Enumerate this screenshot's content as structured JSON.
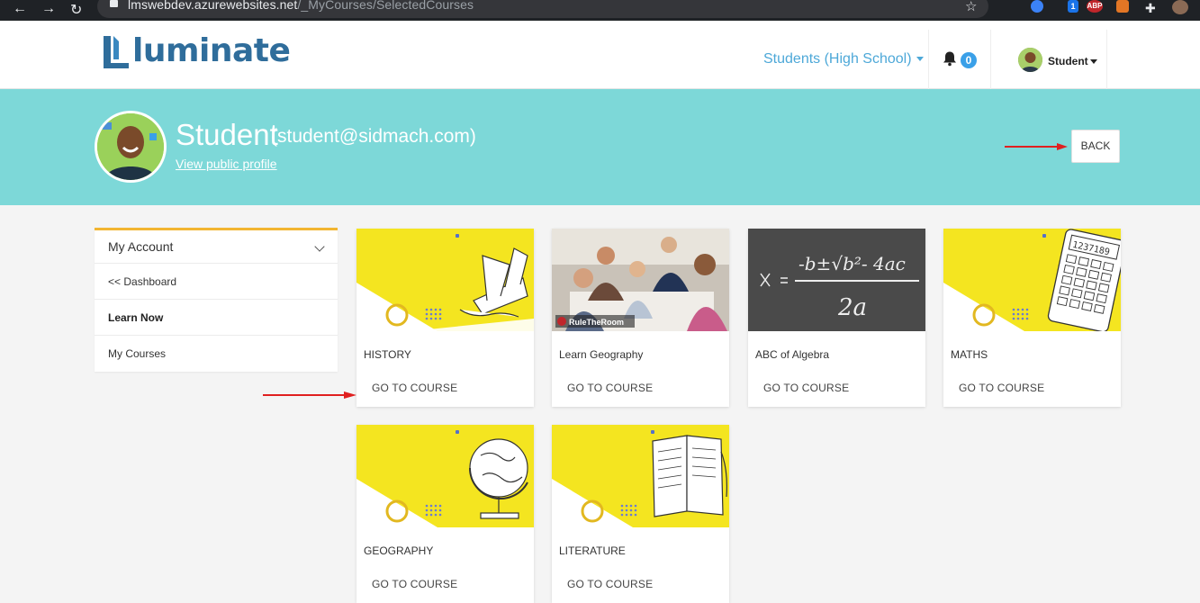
{
  "browser": {
    "url_host": "lmswebdev.azurewebsites.net",
    "url_path": "/_MyCourses/SelectedCourses",
    "ext_badge": "1",
    "abp_label": "ABP"
  },
  "header": {
    "logo_text": "luminate",
    "role_selector": "Students (High School)",
    "notification_count": "0",
    "user_name": "Student"
  },
  "profile": {
    "name": "Student",
    "email": "(student@sidmach.com)",
    "public_profile_link": "View public profile",
    "back_label": "BACK"
  },
  "sidebar": {
    "heading": "My Account",
    "items": [
      {
        "label": "<< Dashboard",
        "active": false
      },
      {
        "label": "Learn Now",
        "active": true
      },
      {
        "label": "My Courses",
        "active": false
      }
    ]
  },
  "courses": [
    {
      "title": "HISTORY",
      "action": "GO TO COURSE"
    },
    {
      "title": "Learn Geography",
      "action": "GO TO COURSE",
      "image_caption": "RuleTheRoom"
    },
    {
      "title": "ABC of Algebra",
      "action": "GO TO COURSE",
      "formula": "-b ± √b² - 4ac / 2a"
    },
    {
      "title": "MATHS",
      "action": "GO TO COURSE",
      "calc_display": "1237189"
    },
    {
      "title": "GEOGRAPHY",
      "action": "GO TO COURSE"
    },
    {
      "title": "LITERATURE",
      "action": "GO TO COURSE"
    }
  ],
  "colors": {
    "banner": "#7dd8d8",
    "accent_yellow": "#f4e520",
    "brand_blue": "#2f6d9b",
    "link_blue": "#4da8d8",
    "annotation_red": "#e02020"
  }
}
